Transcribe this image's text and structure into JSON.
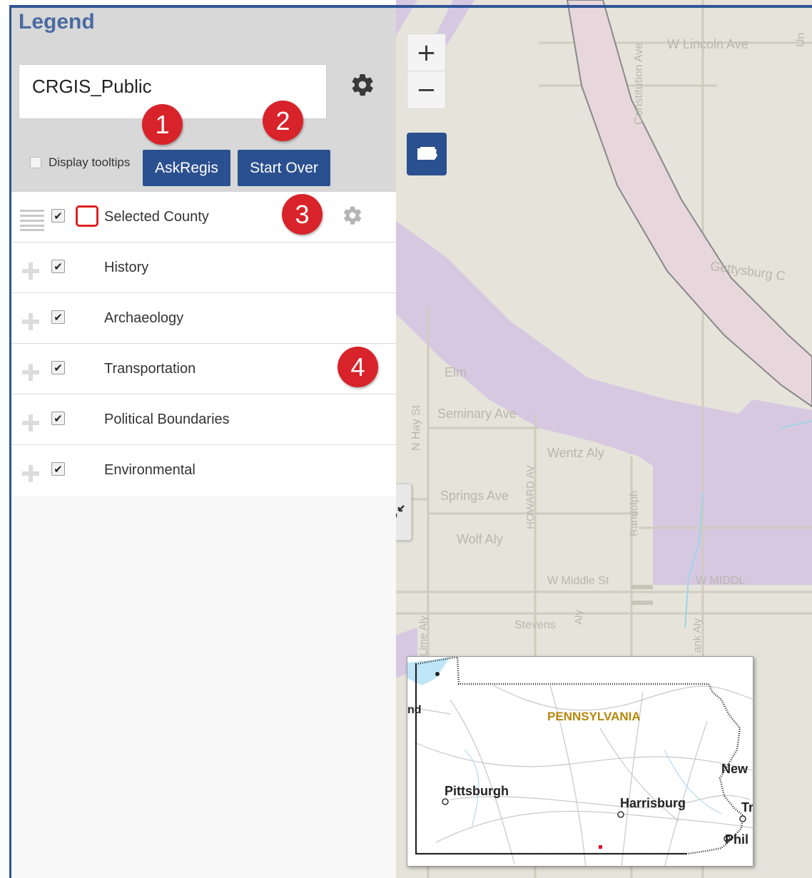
{
  "legend": {
    "title": "Legend",
    "map_select_value": "CRGIS_Public",
    "display_tooltips_label": "Display tooltips",
    "askregis_label": "AskRegis",
    "start_over_label": "Start Over"
  },
  "badges": [
    "1",
    "2",
    "3",
    "4"
  ],
  "layers": [
    {
      "name": "Selected County",
      "checked": true,
      "icons": [
        "drag-handle-icon",
        "checkbox",
        "outline-swatch",
        "gear-icon"
      ]
    },
    {
      "name": "History",
      "checked": true
    },
    {
      "name": "Archaeology",
      "checked": true
    },
    {
      "name": "Transportation",
      "checked": true
    },
    {
      "name": "Political Boundaries",
      "checked": true
    },
    {
      "name": "Environmental",
      "checked": true
    }
  ],
  "map": {
    "zoom_in": "+",
    "zoom_out": "−",
    "street_labels": {
      "w_lincoln": "W Lincoln Ave",
      "constitution": "Constitution Ave",
      "gettysburg": "Gettysburg C",
      "elm": "Elm",
      "n_hay": "N Hay St",
      "seminary": "Seminary Ave",
      "wentz": "Wentz Aly",
      "springs": "Springs Ave",
      "howard": "HOWARD AV",
      "randolph": "Randolph",
      "wolf": "Wolf Aly",
      "w_middle_1": "W Middle St",
      "w_middle_2": "W MIDDL",
      "stevens": "Stevens",
      "lime": "Lime Aly",
      "aly": "Aly",
      "ank": "ank Aly",
      "edge": "Un"
    },
    "overview": {
      "state_label": "PENNSYLVANIA",
      "cities": {
        "pittsburgh": "Pittsburgh",
        "harrisburg": "Harrisburg",
        "new": "New",
        "tr": "Tr",
        "phil": "Phil",
        "nd": "nd"
      },
      "colors": {
        "state_label": "#b8860b",
        "marker": "#e0102a"
      }
    }
  },
  "colors": {
    "accent": "#2b5090",
    "badge": "#d8232a",
    "purple_zone": "#d7c8e2",
    "title": "#4a6aa0"
  }
}
